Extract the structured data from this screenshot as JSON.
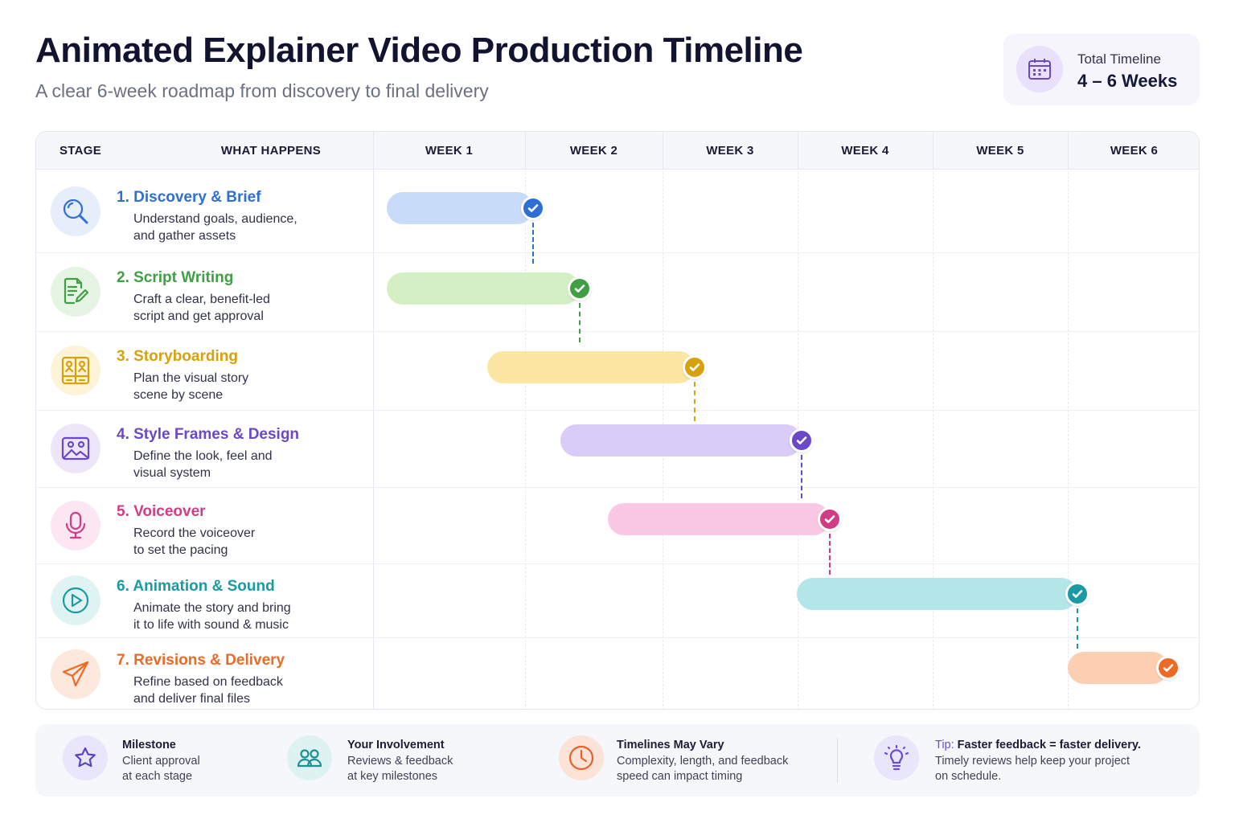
{
  "header": {
    "title": "Animated Explainer Video Production Timeline",
    "subtitle": "A clear 6-week roadmap from discovery to final delivery",
    "total_label": "Total Timeline",
    "total_value": "4 – 6 Weeks",
    "total_icon": "calendar-icon"
  },
  "table": {
    "col_stage": "STAGE",
    "col_what": "WHAT HAPPENS",
    "weeks": [
      "WEEK 1",
      "WEEK 2",
      "WEEK 3",
      "WEEK 4",
      "WEEK 5",
      "WEEK 6"
    ]
  },
  "stages": [
    {
      "title": "1.  Discovery & Brief",
      "desc1": "Understand goals, audience,",
      "desc2": "and gather assets",
      "icon": "magnifier-icon",
      "color": "#2d6fd6",
      "bar_color": "#c8dbf9",
      "icon_bg": "#e6eefb",
      "start_week": 1.0,
      "end_week": 2.06
    },
    {
      "title": "2. Script Writing",
      "desc1": "Craft a clear, benefit-led",
      "desc2": "script and get approval",
      "icon": "document-edit-icon",
      "color": "#3ea042",
      "bar_color": "#d5efc5",
      "icon_bg": "#e6f4e4",
      "start_week": 1.0,
      "end_week": 2.4
    },
    {
      "title": "3. Storyboarding",
      "desc1": "Plan the visual story",
      "desc2": "scene by scene",
      "icon": "storyboard-icon",
      "color": "#d6a10a",
      "bar_color": "#fbe7a3",
      "icon_bg": "#fdf3d6",
      "start_week": 1.66,
      "end_week": 3.24
    },
    {
      "title": "4. Style Frames & Design",
      "desc1": "Define the look, feel and",
      "desc2": "visual system",
      "icon": "image-frame-icon",
      "color": "#6b48c8",
      "bar_color": "#d9ccf8",
      "icon_bg": "#ece6f8",
      "start_week": 2.16,
      "end_week": 4.03
    },
    {
      "title": "5. Voiceover",
      "desc1": "Record the voiceover",
      "desc2": "to set the pacing",
      "icon": "microphone-icon",
      "color": "#d23c84",
      "bar_color": "#fac8e4",
      "icon_bg": "#fbe6f1",
      "start_week": 2.5,
      "end_week": 4.24
    },
    {
      "title": "6. Animation & Sound",
      "desc1": "Animate the story and bring",
      "desc2": "it to life with sound & music",
      "icon": "play-circle-icon",
      "color": "#1a9aa3",
      "bar_color": "#b2e6e9",
      "icon_bg": "#e0f3f3",
      "start_week": 3.89,
      "end_week": 6.07
    },
    {
      "title": "7. Revisions & Delivery",
      "desc1": "Refine based on feedback",
      "desc2": "and deliver final files",
      "icon": "paper-plane-icon",
      "color": "#ee6a24",
      "bar_color": "#fdcfb2",
      "icon_bg": "#fde8de",
      "start_week": 5.9,
      "end_week": 6.76
    }
  ],
  "legend": [
    {
      "title": "Milestone",
      "line1": "Client approval",
      "line2": "at each stage",
      "icon": "star-icon",
      "color": "#5b44c4",
      "bg": "#e9e5fa"
    },
    {
      "title": "Your Involvement",
      "line1": "Reviews & feedback",
      "line2": "at key milestones",
      "icon": "users-icon",
      "color": "#1f8f93",
      "bg": "#dff2f2"
    },
    {
      "title": "Timelines May Vary",
      "line1": "Complexity, length, and feedback",
      "line2": "speed can impact timing",
      "icon": "clock-icon",
      "color": "#e8612a",
      "bg": "#fde3d7"
    },
    {
      "title_prefix": "Tip:",
      "title": " Faster feedback = faster delivery.",
      "line1": "Timely reviews help keep your project",
      "line2": "on schedule.",
      "icon": "lightbulb-icon",
      "color": "#6a4fc9",
      "bg": "#e9e5fa"
    }
  ]
}
